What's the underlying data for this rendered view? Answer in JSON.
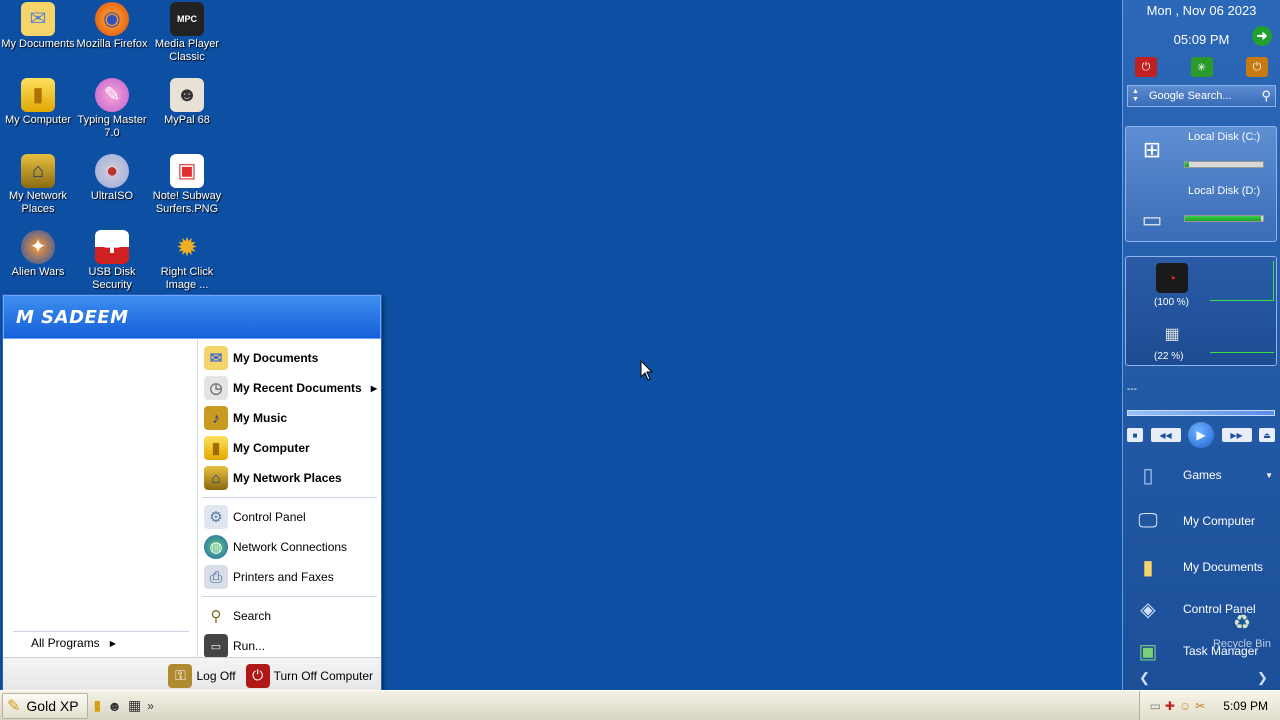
{
  "desktop": {
    "icons": [
      {
        "label": "My Documents"
      },
      {
        "label": "Mozilla Firefox"
      },
      {
        "label": "Media Player Classic"
      },
      {
        "label": "My Computer"
      },
      {
        "label": "Typing Master 7.0"
      },
      {
        "label": "MyPal 68"
      },
      {
        "label": "My Network Places"
      },
      {
        "label": "UltraISO"
      },
      {
        "label": "Note! Subway Surfers.PNG"
      },
      {
        "label": "Alien Wars"
      },
      {
        "label": "USB Disk Security"
      },
      {
        "label": "Right Click Image ..."
      }
    ],
    "background_color": "#0d4fa2"
  },
  "start_menu": {
    "user_name": "M SADEEM",
    "places": [
      {
        "label": "My Documents",
        "icon": "folder-docs-icon"
      },
      {
        "label": "My Recent Documents",
        "icon": "recent-docs-icon"
      },
      {
        "label": "My Music",
        "icon": "music-folder-icon"
      },
      {
        "label": "My Computer",
        "icon": "computer-icon"
      },
      {
        "label": "My Network Places",
        "icon": "network-places-icon"
      }
    ],
    "settings": [
      {
        "label": "Control Panel",
        "icon": "control-panel-icon"
      },
      {
        "label": "Network Connections",
        "icon": "globe-network-icon"
      },
      {
        "label": "Printers and Faxes",
        "icon": "printer-icon"
      }
    ],
    "tools": [
      {
        "label": "Search",
        "icon": "search-icon"
      },
      {
        "label": "Run...",
        "icon": "run-icon"
      }
    ],
    "all_programs": "All Programs",
    "log_off": "Log Off",
    "turn_off": "Turn Off Computer"
  },
  "sidebar": {
    "date": "Mon , Nov 06 2023",
    "time": "05:09 PM",
    "search_placeholder": "Google Search...",
    "disk_c_label": "Local Disk (C:)",
    "disk_c_used": 0.05,
    "disk_d_label": "Local Disk (D:)",
    "disk_d_used": 0.98,
    "cpu_percent": "(100 %)",
    "ram_percent": "(22 %)",
    "player_title": "---",
    "links": [
      {
        "label": "Games",
        "icon": "games-folder-icon"
      },
      {
        "label": "My Computer",
        "icon": "computer-icon"
      },
      {
        "label": "My Documents",
        "icon": "folder-docs-icon"
      },
      {
        "label": "Control Panel",
        "icon": "control-panel-icon"
      },
      {
        "label": "Task Manager",
        "icon": "task-manager-icon"
      }
    ],
    "recycle_bin": "Recycle Bin"
  },
  "taskbar": {
    "start_label": "Gold XP",
    "quick_launch_more": "»",
    "clock": "5:09 PM"
  },
  "colors": {
    "accent": "#1660d8",
    "disk_fill": "#15a025"
  }
}
